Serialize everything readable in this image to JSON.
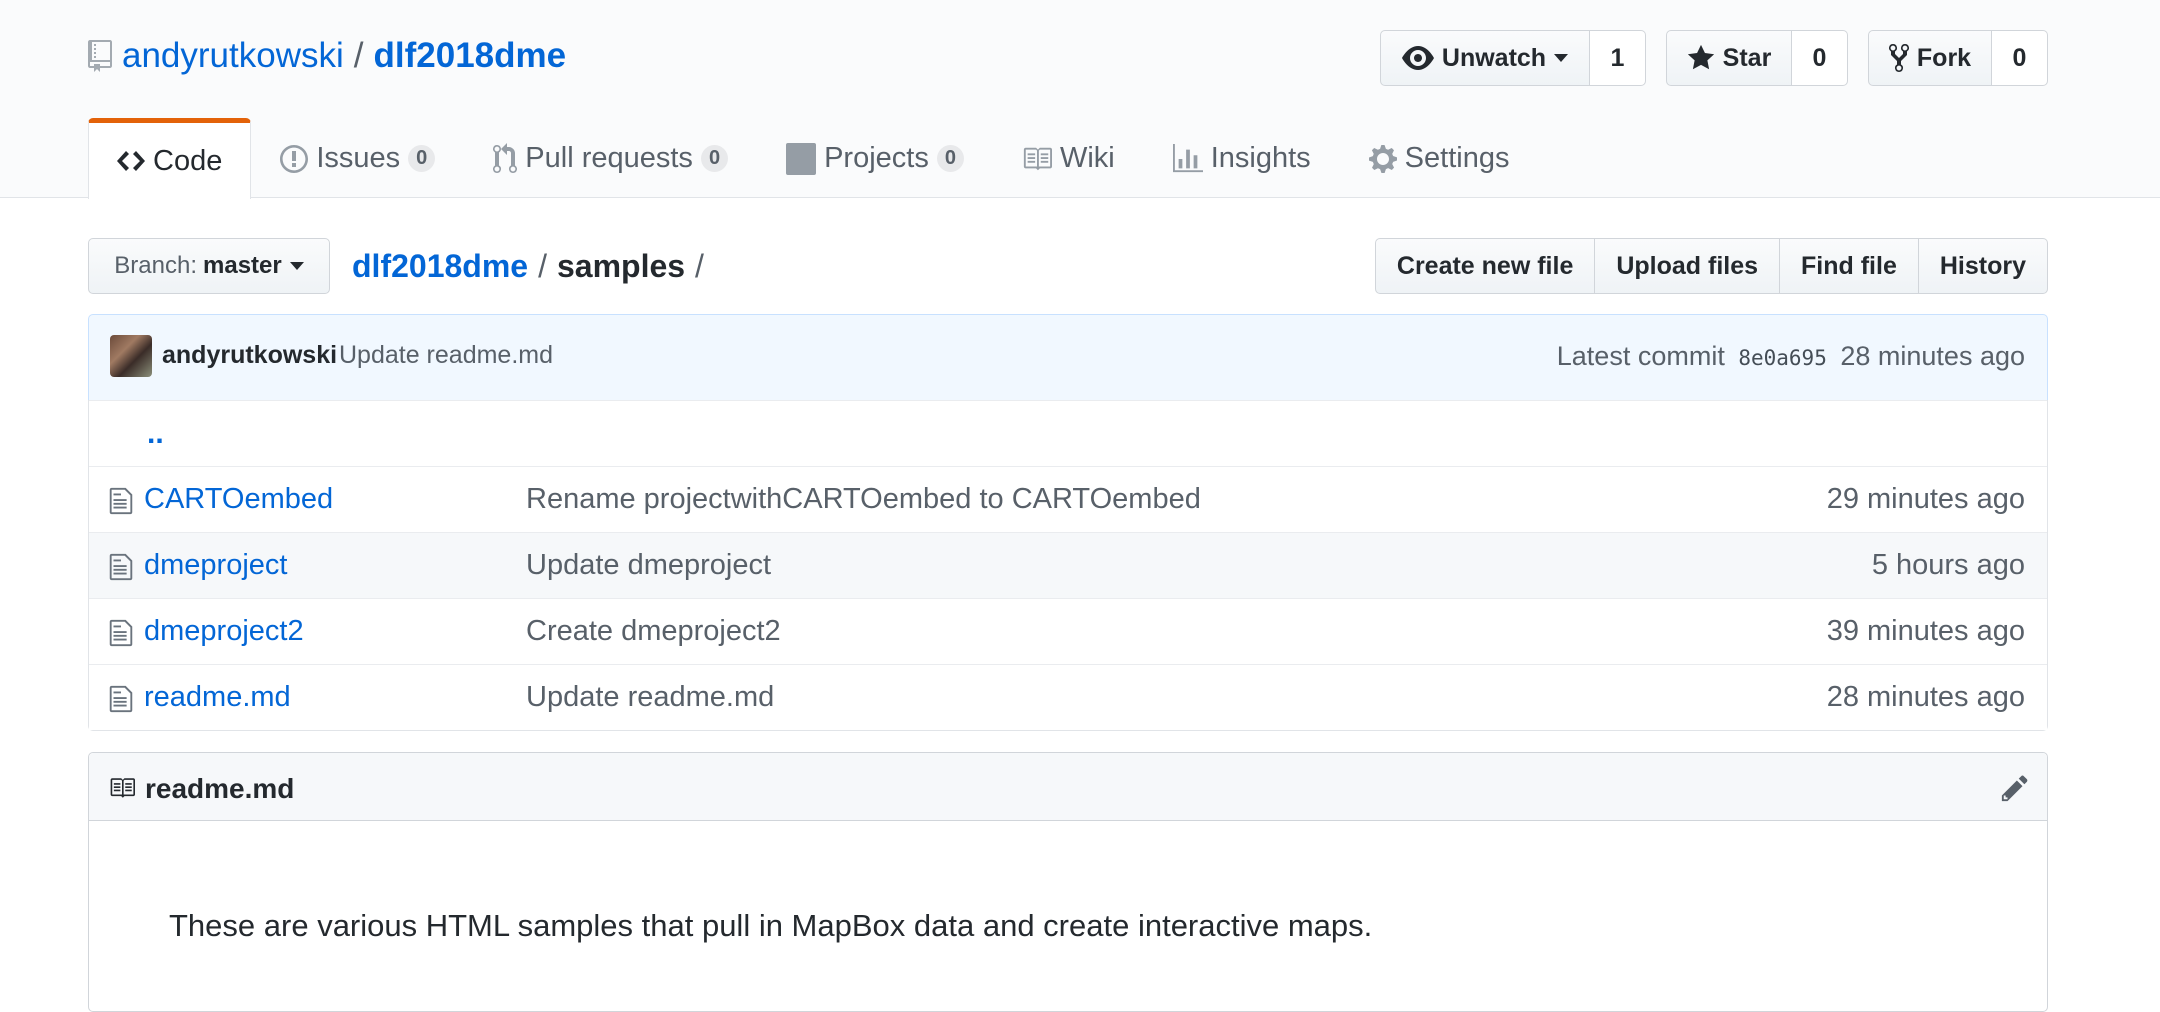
{
  "repo": {
    "owner": "andyrutkowski",
    "separator": "/",
    "name": "dlf2018dme"
  },
  "actions": {
    "watch": {
      "label": "Unwatch",
      "count": "1"
    },
    "star": {
      "label": "Star",
      "count": "0"
    },
    "fork": {
      "label": "Fork",
      "count": "0"
    }
  },
  "nav": {
    "code": "Code",
    "issues": {
      "label": "Issues",
      "count": "0"
    },
    "pulls": {
      "label": "Pull requests",
      "count": "0"
    },
    "projects": {
      "label": "Projects",
      "count": "0"
    },
    "wiki": "Wiki",
    "insights": "Insights",
    "settings": "Settings"
  },
  "branch": {
    "label": "Branch:",
    "value": "master"
  },
  "breadcrumb": {
    "root": "dlf2018dme",
    "sep1": "/",
    "current": "samples",
    "sep2": "/"
  },
  "file_actions": {
    "create": "Create new file",
    "upload": "Upload files",
    "find": "Find file",
    "history": "History"
  },
  "commit": {
    "author": "andyrutkowski",
    "message": "Update readme.md",
    "latest_label": "Latest commit",
    "sha": "8e0a695",
    "age": "28 minutes ago"
  },
  "files": {
    "parent": "..",
    "rows": [
      {
        "name": "CARTOembed",
        "message": "Rename projectwithCARTOembed to CARTOembed",
        "age": "29 minutes ago"
      },
      {
        "name": "dmeproject",
        "message": "Update dmeproject",
        "age": "5 hours ago"
      },
      {
        "name": "dmeproject2",
        "message": "Create dmeproject2",
        "age": "39 minutes ago"
      },
      {
        "name": "readme.md",
        "message": "Update readme.md",
        "age": "28 minutes ago"
      }
    ]
  },
  "readme": {
    "title": "readme.md",
    "body": "These are various HTML samples that pull in MapBox data and create interactive maps."
  },
  "colors": {
    "link": "#0366d6",
    "tab_accent": "#e36209",
    "commit_bg": "#f1f8ff"
  }
}
